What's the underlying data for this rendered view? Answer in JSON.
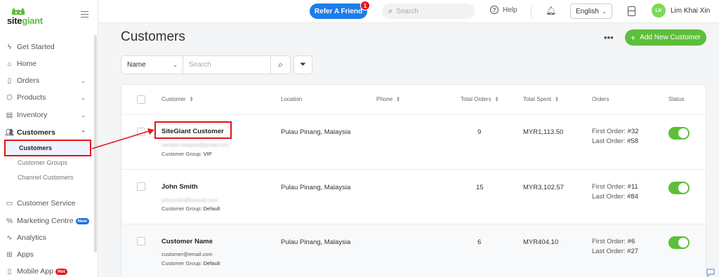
{
  "sidebar": {
    "logo": {
      "part1": "site",
      "part2": "giant"
    },
    "items": [
      {
        "label": "Get Started",
        "icon": "lightning-icon"
      },
      {
        "label": "Home",
        "icon": "home-icon"
      },
      {
        "label": "Orders",
        "icon": "document-icon"
      },
      {
        "label": "Products",
        "icon": "box-icon"
      },
      {
        "label": "Inventory",
        "icon": "inventory-icon"
      },
      {
        "label": "Customers",
        "icon": "users-icon"
      },
      {
        "label": "Customer Service",
        "icon": "chat-bubble-icon"
      },
      {
        "label": "Marketing Centre",
        "icon": "percent-icon",
        "badge": "New"
      },
      {
        "label": "Analytics",
        "icon": "pulse-icon"
      },
      {
        "label": "Apps",
        "icon": "grid-icon"
      },
      {
        "label": "Mobile App",
        "icon": "phone-icon",
        "badge": "Hot"
      }
    ],
    "sub_items": [
      "Customers",
      "Customer Groups",
      "Channel Customers"
    ]
  },
  "topbar": {
    "refer_label": "Refer A Friend",
    "refer_badge": "1",
    "search_placeholder": "Search",
    "help_label": "Help",
    "language": "English",
    "avatar_initials": "LK",
    "username": "Lim Khai Xin"
  },
  "page": {
    "title": "Customers",
    "more_label": "•••",
    "add_button": "Add New Customer"
  },
  "filter": {
    "field": "Name",
    "search_placeholder": "Search"
  },
  "table": {
    "headers": {
      "customer": "Customer",
      "location": "Location",
      "phone": "Phone",
      "total_orders": "Total Orders",
      "total_spent": "Total Spent",
      "orders": "Orders",
      "status": "Status"
    },
    "rows": [
      {
        "name": "SiteGiant Customer",
        "email": "sample.sitegiant@gmail.com",
        "group_prefix": "Customer Group:",
        "group": "VIP",
        "location": "Pulau Pinang, Malaysia",
        "phone": "",
        "total_orders": "9",
        "total_spent": "MYR1,113.50",
        "first_prefix": "First Order:",
        "first": "#32",
        "last_prefix": "Last Order:",
        "last": "#58",
        "status": true
      },
      {
        "name": "John Smith",
        "email": "johnsmith@hotmail.com",
        "group_prefix": "Customer Group:",
        "group": "Default",
        "location": "Pulau Pinang, Malaysia",
        "phone": "",
        "total_orders": "15",
        "total_spent": "MYR3,102.57",
        "first_prefix": "First Order:",
        "first": "#11",
        "last_prefix": "Last Order:",
        "last": "#84",
        "status": true
      },
      {
        "name": "Customer Name",
        "email": "customer@email.com",
        "group_prefix": "Customer Group:",
        "group": "Default",
        "location": "Pulau Pinang, Malaysia",
        "phone": "",
        "total_orders": "6",
        "total_spent": "MYR404.10",
        "first_prefix": "First Order:",
        "first": "#6",
        "last_prefix": "Last Order:",
        "last": "#27",
        "status": true
      }
    ]
  },
  "colors": {
    "accent_green": "#5cbf3a",
    "brand_blue": "#1e7ce8",
    "highlight_red": "#e5131a"
  }
}
